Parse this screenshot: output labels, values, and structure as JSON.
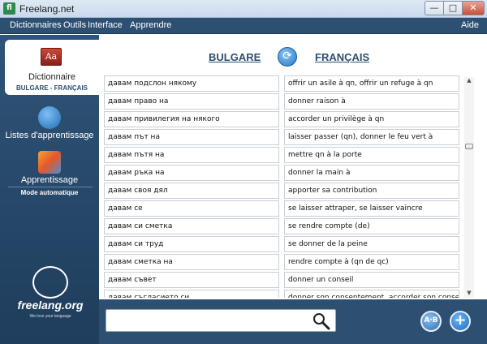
{
  "window": {
    "title": "Freelang.net",
    "minimize": "—",
    "maximize": "□",
    "close": "✕"
  },
  "menu": [
    "Dictionnaires",
    "Outils",
    "Interface",
    "Apprendre"
  ],
  "menu_right": "Aide",
  "sidebar": {
    "dictionary": {
      "label": "Dictionnaire",
      "sub": "BULGARE - FRANÇAIS",
      "icon": "dictionary-book-icon"
    },
    "lists": {
      "label": "Listes d'apprentissage",
      "icon": "globe-graduation-icon"
    },
    "learning": {
      "label": "Apprentissage",
      "sub": "Mode automatique",
      "icon": "learning-cube-icon"
    },
    "logo": {
      "text": "freelang.org",
      "tagline": "We love your language"
    }
  },
  "languages": {
    "from": "BULGARE",
    "to": "FRANÇAIS"
  },
  "entries": [
    {
      "bg": "давам подслон някому",
      "fr": "offrir un asile à qn, offrir un refuge à qn"
    },
    {
      "bg": "давам право на",
      "fr": "donner raison à"
    },
    {
      "bg": "давам привилегия на някого",
      "fr": "accorder un privilège à qn"
    },
    {
      "bg": "давам път на",
      "fr": "laisser passer (qn), donner le feu vert à"
    },
    {
      "bg": "давам пътя на",
      "fr": "mettre qn à la porte"
    },
    {
      "bg": "давам ръка на",
      "fr": "donner la main à"
    },
    {
      "bg": "давам своя дял",
      "fr": "apporter sa contribution"
    },
    {
      "bg": "давам се",
      "fr": "se laisser attraper, se laisser vaincre"
    },
    {
      "bg": "давам си сметка",
      "fr": "se rendre compte (de)"
    },
    {
      "bg": "давам си труд",
      "fr": "se donner de la peine"
    },
    {
      "bg": "давам сметка на",
      "fr": "rendre compte à (qn de qc)"
    },
    {
      "bg": "давам съвет",
      "fr": "donner un conseil"
    },
    {
      "bg": "давам съгласието си",
      "fr": "donner son consentement, accorder son consentement"
    }
  ],
  "search": {
    "value": "",
    "placeholder": ""
  },
  "buttons": {
    "extra": "A·B",
    "add": "+"
  },
  "scroll": {
    "up": "▲",
    "down": "▼"
  },
  "colors": {
    "nav": "#2c4f72",
    "accent": "#2677c4",
    "close": "#c7503a"
  }
}
